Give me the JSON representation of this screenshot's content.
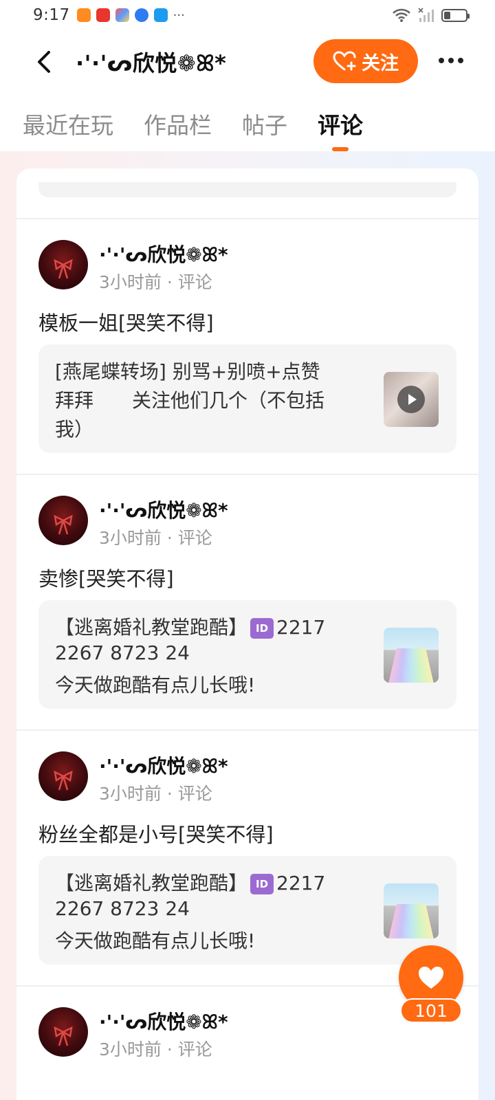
{
  "status_bar": {
    "time": "9:17",
    "more": "···",
    "battery_level": 0.3
  },
  "header": {
    "user_name": "·'·'ᔕ欣悦❁ꕤ*",
    "follow_label": "关注"
  },
  "tabs": [
    {
      "label": "最近在玩"
    },
    {
      "label": "作品栏"
    },
    {
      "label": "帖子"
    },
    {
      "label": "评论",
      "active": true
    }
  ],
  "comments": [
    {
      "user": "·'·'ᔕ欣悦❁ꕤ*",
      "meta": "3小时前 · 评论",
      "text": "模板一姐[哭笑不得]",
      "quote_lines": [
        "[燕尾蝶转场] 别骂+别喷+点赞",
        " 拜拜　　关注他们几个（不包括",
        "我）"
      ],
      "thumb": "video"
    },
    {
      "user": "·'·'ᔕ欣悦❁ꕤ*",
      "meta": "3小时前 · 评论",
      "text": "卖惨[哭笑不得]",
      "quote_lines": [
        "【逃离婚礼教堂跑酷】",
        "2267 8723 24",
        "今天做跑酷有点儿长哦!"
      ],
      "quote_id_badge": "ID",
      "quote_id_tail": "2217",
      "thumb": "parkour"
    },
    {
      "user": "·'·'ᔕ欣悦❁ꕤ*",
      "meta": "3小时前 · 评论",
      "text": "粉丝全都是小号[哭笑不得]",
      "quote_lines": [
        "【逃离婚礼教堂跑酷】",
        "2267 8723 24",
        "今天做跑酷有点儿长哦!"
      ],
      "quote_id_badge": "ID",
      "quote_id_tail": "2217",
      "thumb": "parkour"
    },
    {
      "user": "·'·'ᔕ欣悦❁ꕤ*",
      "meta": "3小时前 · 评论"
    }
  ],
  "like_button": {
    "count": "101"
  },
  "colors": {
    "accent": "#ff6a12",
    "tab_inactive": "#8c8c8c"
  }
}
